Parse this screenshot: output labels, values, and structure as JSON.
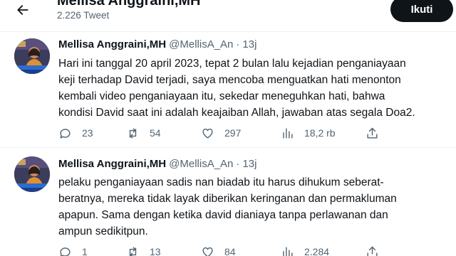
{
  "header": {
    "display_name": "Mellisa Anggraini,MH",
    "tweet_count": "2.226 Tweet",
    "follow_label": "Ikuti"
  },
  "tweets": [
    {
      "name": "Mellisa Anggraini,MH",
      "handle": "@MellisA_An",
      "separator": "·",
      "time": "13j",
      "lines": [
        "Hari ini tanggal 20 april 2023, tepat 2 bulan lalu kejadian penganiayaan",
        "keji terhadap David terjadi, saya mencoba menguatkan hati menonton",
        "kembali video penganiayaan itu, sekedar meneguhkan hati, bahwa",
        "kondisi David saat ini adalah keajaiban Allah, jawaban atas segala Doa2."
      ],
      "replies": "23",
      "retweets": "54",
      "likes": "297",
      "views": "18,2 rb"
    },
    {
      "name": "Mellisa Anggraini,MH",
      "handle": "@MellisA_An",
      "separator": "·",
      "time": "13j",
      "lines": [
        "pelaku penganiayaan sadis nan biadab itu harus dihukum seberat-",
        "beratnya, mereka tidak layak diberikan keringanan dan permakluman",
        "apapun. Sama dengan ketika david dianiaya tanpa perlawanan dan",
        "ampun sedikitpun."
      ],
      "replies": "1",
      "retweets": "13",
      "likes": "84",
      "views": "2.284"
    }
  ],
  "icons": {
    "back": "arrow-left-icon",
    "reply": "reply-icon",
    "retweet": "retweet-icon",
    "like": "heart-icon",
    "views": "views-chart-icon",
    "share": "share-icon"
  },
  "colors": {
    "text": "#0f1419",
    "secondary": "#536471",
    "follow_button": "#0f1419",
    "divider": "#eff3f4"
  }
}
